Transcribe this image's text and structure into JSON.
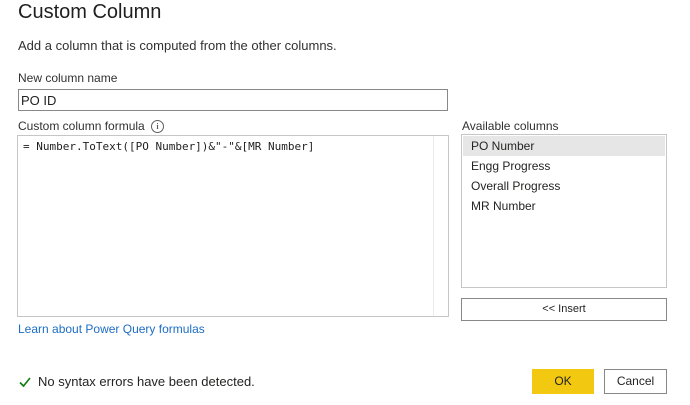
{
  "dialog": {
    "title": "Custom Column",
    "description": "Add a column that is computed from the other columns."
  },
  "new_column": {
    "label": "New column name",
    "value": "PO ID"
  },
  "formula": {
    "label": "Custom column formula",
    "value": "= Number.ToText([PO Number])&\"-\"&[MR Number]"
  },
  "available_columns": {
    "label": "Available columns",
    "items": [
      {
        "label": "PO Number"
      },
      {
        "label": "Engg Progress"
      },
      {
        "label": "Overall Progress"
      },
      {
        "label": "MR Number"
      }
    ],
    "insert_label": "<< Insert"
  },
  "learn_link": "Learn about Power Query formulas",
  "status": {
    "text": "No syntax errors have been detected.",
    "color": "#107c10"
  },
  "buttons": {
    "ok": "OK",
    "cancel": "Cancel",
    "ok_color": "#f2c811"
  }
}
